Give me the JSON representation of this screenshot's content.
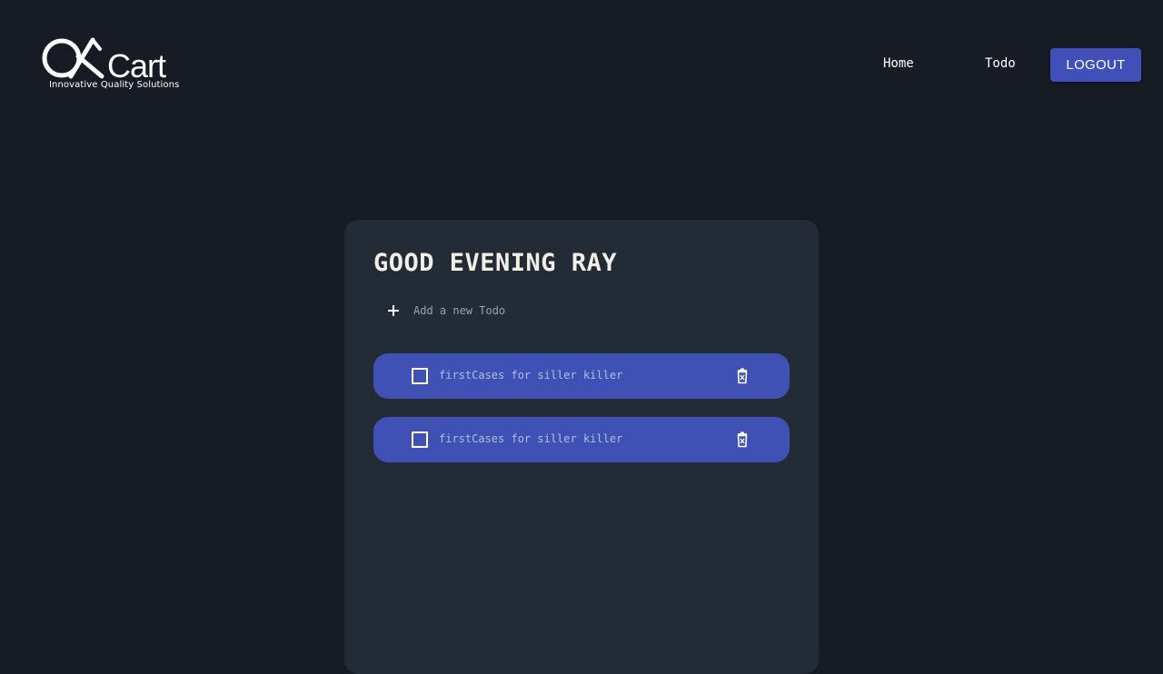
{
  "header": {
    "logo": {
      "wordmark": "QACart",
      "tagline": "Innovative Quality Solutions"
    },
    "nav": [
      {
        "label": "Home"
      },
      {
        "label": "Todo"
      }
    ],
    "logout_label": "LOGOUT"
  },
  "main": {
    "greeting": "GOOD EVENING RAY",
    "add_todo_label": "Add a new Todo",
    "todos": [
      {
        "text": "firstCases for siller killer",
        "completed": false
      },
      {
        "text": "firstCases for siller killer",
        "completed": false
      }
    ]
  },
  "colors": {
    "background": "#171c24",
    "card": "#222b36",
    "accent": "#3f51b5",
    "logout_button": "#4050b8"
  },
  "icons": {
    "add": "plus-icon",
    "checkbox": "checkbox-empty-icon",
    "delete": "trash-icon"
  }
}
